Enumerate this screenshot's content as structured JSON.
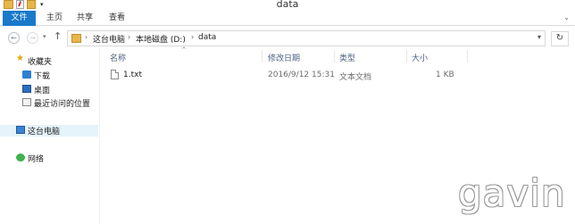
{
  "window": {
    "title": "data"
  },
  "quick_access": {
    "icons": [
      "folder-icon",
      "properties-icon",
      "new-folder-icon",
      "customize-dropdown-icon"
    ]
  },
  "ribbon": {
    "tabs": [
      {
        "label": "文件"
      },
      {
        "label": "主页"
      },
      {
        "label": "共享"
      },
      {
        "label": "查看"
      }
    ]
  },
  "address": {
    "crumbs": [
      "这台电脑",
      "本地磁盘 (D:)",
      "data"
    ]
  },
  "navpane": {
    "favorites": {
      "label": "收藏夹",
      "icon": "star-icon"
    },
    "favorite_items": [
      {
        "label": "下载",
        "icon": "download-icon"
      },
      {
        "label": "桌面",
        "icon": "desktop-icon"
      },
      {
        "label": "最近访问的位置",
        "icon": "recent-icon"
      }
    ],
    "this_pc": {
      "label": "这台电脑",
      "icon": "pc-icon"
    },
    "network": {
      "label": "网络",
      "icon": "network-icon"
    }
  },
  "columns": {
    "name": "名称",
    "modified": "修改日期",
    "type": "类型",
    "size": "大小"
  },
  "files": [
    {
      "name": "1.txt",
      "modified": "2016/9/12 15:31",
      "type": "文本文档",
      "size": "1 KB"
    }
  ],
  "watermark": "gavin",
  "colors": {
    "file_tab": "#1979ca",
    "selection": "#e5f3fb",
    "header_text": "#4d6082"
  }
}
